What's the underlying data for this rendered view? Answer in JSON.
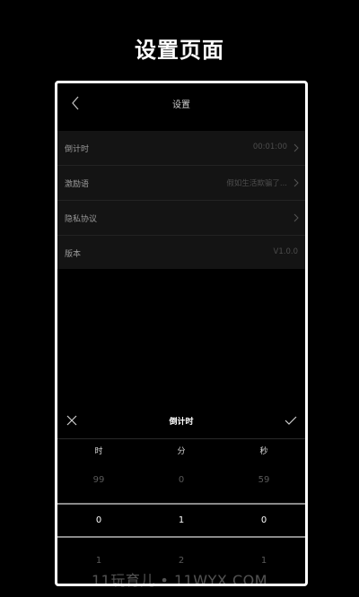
{
  "heading": "设置页面",
  "navbar": {
    "title": "设置"
  },
  "settings": {
    "rows": [
      {
        "label": "倒计时",
        "value": "00:01:00"
      },
      {
        "label": "激励语",
        "value": "假如生活欺骗了..."
      },
      {
        "label": "隐私协议",
        "value": ""
      },
      {
        "label": "版本",
        "value": "V1.0.0"
      }
    ]
  },
  "picker": {
    "title": "倒计时",
    "columns": [
      {
        "label": "时",
        "above": "99",
        "selected": "0",
        "below": "1"
      },
      {
        "label": "分",
        "above": "0",
        "selected": "1",
        "below": "2"
      },
      {
        "label": "秒",
        "above": "59",
        "selected": "0",
        "below": "1"
      }
    ]
  },
  "watermark": "11玩育儿 • 11WYX.COM",
  "colors": {
    "background": "#000000",
    "card": "#141414",
    "text_secondary": "#9a9a9a"
  }
}
